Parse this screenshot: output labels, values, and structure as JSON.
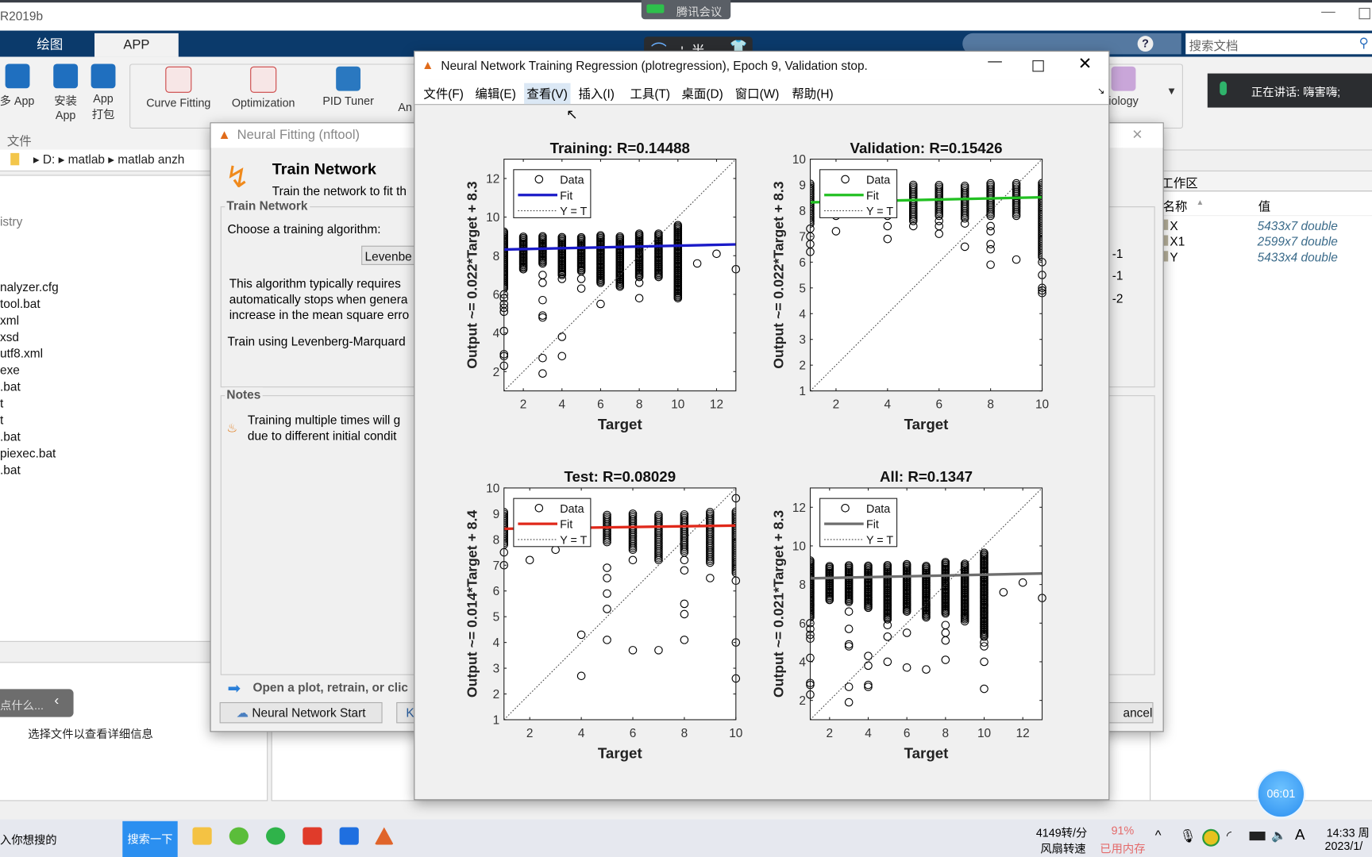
{
  "app": {
    "title": "R2019b"
  },
  "meeting": {
    "badge": "腾讯会议",
    "ime": "', 半",
    "speaking": "正在讲话: 嗨害嗨;"
  },
  "ribbon": {
    "tabs": [
      {
        "label": "绘图"
      },
      {
        "label": "APP",
        "selected": true
      }
    ],
    "file_buttons": [
      {
        "label": "多 App"
      },
      {
        "label": "安装\nApp"
      },
      {
        "label": "App\n打包"
      }
    ],
    "file_section": "文件",
    "apps": [
      {
        "label": "Curve Fitting"
      },
      {
        "label": "Optimization"
      },
      {
        "label": "PID Tuner"
      },
      {
        "label": "An"
      },
      {
        "label": "iology"
      }
    ],
    "search_placeholder": "搜索文档"
  },
  "address": {
    "parts": [
      "D:",
      "matlab",
      "matlab anzh"
    ]
  },
  "files": {
    "items": [
      "istry",
      "nalyzer.cfg",
      "tool.bat",
      "xml",
      "xsd",
      "utf8.xml",
      "exe",
      ".bat",
      "t",
      "t",
      ".bat",
      "piexec.bat",
      ".bat"
    ],
    "details_hint": "选择文件以查看详细信息",
    "search_pill": "点什么..."
  },
  "nftool": {
    "title": "Neural Fitting (nftool)",
    "heading": "Train Network",
    "subheading": "Train the network to fit th",
    "group_train": "Train Network",
    "choose_label": "Choose a training algorithm:",
    "algorithm_value": "Levenbe",
    "desc_lines": [
      "This algorithm typically requires",
      "automatically stops when genera",
      "increase in the mean square erro"
    ],
    "train_using": "Train using Levenberg-Marquard",
    "group_notes": "Notes",
    "notes_lines": [
      "Training multiple times will g",
      "due to different initial condit"
    ],
    "hint": "Open a plot, retrain, or clic",
    "start_button": "Neural Network Start",
    "next_button": "K",
    "cancel_button": "ancel",
    "right_values": [
      "-1",
      "-1",
      "-2"
    ]
  },
  "workspace": {
    "title": "工作区",
    "col_name": "名称",
    "col_value": "值",
    "rows": [
      {
        "name": "X",
        "value": "5433x7 double"
      },
      {
        "name": "X1",
        "value": "2599x7 double"
      },
      {
        "name": "Y",
        "value": "5433x4 double"
      }
    ]
  },
  "plotwin": {
    "title": "Neural Network Training Regression (plotregression), Epoch 9, Validation stop.",
    "menu": [
      "文件(F)",
      "编辑(E)",
      "查看(V)",
      "插入(I)",
      "工具(T)",
      "桌面(D)",
      "窗口(W)",
      "帮助(H)"
    ],
    "active_menu": "查看(V)"
  },
  "chart_data": [
    {
      "type": "scatter",
      "title": "Training: R=0.14488",
      "xlabel": "Target",
      "ylabel": "Output ~= 0.022*Target + 8.3",
      "xlim": [
        1,
        13
      ],
      "ylim": [
        1,
        13
      ],
      "xticks": [
        2,
        4,
        6,
        8,
        10,
        12
      ],
      "yticks": [
        2,
        4,
        6,
        8,
        10,
        12
      ],
      "fit": {
        "slope": 0.022,
        "intercept": 8.3,
        "color": "#1a1ac8"
      },
      "legend": [
        "Data",
        "Fit",
        "Y = T"
      ],
      "legend_position": "top-left",
      "columns": [
        [
          1,
          6.3,
          9.3
        ],
        [
          2,
          7.3,
          9.0
        ],
        [
          3,
          7.6,
          9.0
        ],
        [
          4,
          7.0,
          9.0
        ],
        [
          5,
          7.2,
          9.0
        ],
        [
          6,
          6.6,
          9.1
        ],
        [
          7,
          6.4,
          9.0
        ],
        [
          8,
          6.9,
          9.2
        ],
        [
          9,
          6.9,
          9.2
        ],
        [
          10,
          5.8,
          9.6
        ]
      ],
      "points": [
        [
          1,
          6.0
        ],
        [
          1,
          5.8
        ],
        [
          1,
          5.5
        ],
        [
          1,
          5.3
        ],
        [
          1,
          5.1
        ],
        [
          1,
          4.1
        ],
        [
          1,
          2.9
        ],
        [
          1,
          2.8
        ],
        [
          1,
          2.3
        ],
        [
          3,
          7.0
        ],
        [
          3,
          6.6
        ],
        [
          3,
          5.7
        ],
        [
          3,
          4.9
        ],
        [
          3,
          4.8
        ],
        [
          3,
          2.7
        ],
        [
          3,
          1.9
        ],
        [
          4,
          6.8
        ],
        [
          4,
          3.8
        ],
        [
          4,
          2.8
        ],
        [
          5,
          6.8
        ],
        [
          5,
          6.3
        ],
        [
          6,
          5.5
        ],
        [
          8,
          6.6
        ],
        [
          8,
          5.8
        ],
        [
          11,
          7.6
        ],
        [
          12,
          8.1
        ],
        [
          13,
          7.3
        ]
      ]
    },
    {
      "type": "scatter",
      "title": "Validation: R=0.15426",
      "xlabel": "Target",
      "ylabel": "Output ~= 0.022*Target + 8.3",
      "xlim": [
        1,
        10
      ],
      "ylim": [
        1,
        10
      ],
      "xticks": [
        2,
        4,
        6,
        8,
        10
      ],
      "yticks": [
        1,
        2,
        3,
        4,
        5,
        6,
        7,
        8,
        9,
        10
      ],
      "fit": {
        "slope": 0.022,
        "intercept": 8.3,
        "color": "#22c022"
      },
      "legend": [
        "Data",
        "Fit",
        "Y = T"
      ],
      "legend_position": "top-left",
      "columns": [
        [
          1,
          7.5,
          9.1
        ],
        [
          5,
          7.6,
          9.0
        ],
        [
          6,
          7.8,
          9.0
        ],
        [
          7,
          7.7,
          9.0
        ],
        [
          8,
          7.8,
          9.1
        ],
        [
          9,
          7.8,
          9.1
        ],
        [
          10,
          6.2,
          9.1
        ]
      ],
      "points": [
        [
          1,
          7.3
        ],
        [
          1,
          7.0
        ],
        [
          1,
          6.7
        ],
        [
          1,
          6.4
        ],
        [
          2,
          7.8
        ],
        [
          2,
          7.2
        ],
        [
          4,
          7.8
        ],
        [
          4,
          7.4
        ],
        [
          4,
          6.9
        ],
        [
          5,
          7.4
        ],
        [
          6,
          7.6
        ],
        [
          6,
          7.4
        ],
        [
          6,
          7.1
        ],
        [
          7,
          7.5
        ],
        [
          7,
          6.6
        ],
        [
          8,
          7.4
        ],
        [
          8,
          7.2
        ],
        [
          8,
          6.7
        ],
        [
          8,
          6.5
        ],
        [
          8,
          5.9
        ],
        [
          9,
          6.1
        ],
        [
          10,
          6.0
        ],
        [
          10,
          5.5
        ],
        [
          10,
          5.0
        ],
        [
          10,
          4.9
        ],
        [
          10,
          4.8
        ]
      ]
    },
    {
      "type": "scatter",
      "title": "Test: R=0.08029",
      "xlabel": "Target",
      "ylabel": "Output ~= 0.014*Target + 8.4",
      "xlim": [
        1,
        10
      ],
      "ylim": [
        1,
        10
      ],
      "xticks": [
        2,
        4,
        6,
        8,
        10
      ],
      "yticks": [
        1,
        2,
        3,
        4,
        5,
        6,
        7,
        8,
        9,
        10
      ],
      "fit": {
        "slope": 0.014,
        "intercept": 8.4,
        "color": "#e0281a"
      },
      "legend": [
        "Data",
        "Fit",
        "Y = T"
      ],
      "legend_position": "top-left",
      "columns": [
        [
          1,
          7.8,
          9.1
        ],
        [
          5,
          7.9,
          9.0
        ],
        [
          6,
          7.6,
          9.0
        ],
        [
          7,
          7.2,
          9.0
        ],
        [
          8,
          7.5,
          9.0
        ],
        [
          9,
          7.1,
          9.1
        ],
        [
          10,
          6.7,
          9.1
        ]
      ],
      "points": [
        [
          1,
          7.5
        ],
        [
          1,
          7.0
        ],
        [
          2,
          7.2
        ],
        [
          3,
          7.6
        ],
        [
          4,
          4.3
        ],
        [
          4,
          2.7
        ],
        [
          5,
          6.9
        ],
        [
          5,
          6.5
        ],
        [
          5,
          5.9
        ],
        [
          5,
          5.3
        ],
        [
          5,
          4.1
        ],
        [
          6,
          7.2
        ],
        [
          6,
          3.7
        ],
        [
          7,
          3.7
        ],
        [
          8,
          7.2
        ],
        [
          8,
          6.8
        ],
        [
          8,
          5.5
        ],
        [
          8,
          5.1
        ],
        [
          8,
          4.1
        ],
        [
          9,
          6.5
        ],
        [
          10,
          9.6
        ],
        [
          10,
          6.4
        ],
        [
          10,
          4.0
        ],
        [
          10,
          2.6
        ]
      ]
    },
    {
      "type": "scatter",
      "title": "All: R=0.1347",
      "xlabel": "Target",
      "ylabel": "Output ~= 0.021*Target + 8.3",
      "xlim": [
        1,
        13
      ],
      "ylim": [
        1,
        13
      ],
      "xticks": [
        2,
        4,
        6,
        8,
        10,
        12
      ],
      "yticks": [
        2,
        4,
        6,
        8,
        10,
        12
      ],
      "fit": {
        "slope": 0.021,
        "intercept": 8.3,
        "color": "#6e6e6e"
      },
      "legend": [
        "Data",
        "Fit",
        "Y = T"
      ],
      "legend_position": "top-left",
      "columns": [
        [
          1,
          6.3,
          9.3
        ],
        [
          2,
          7.2,
          9.0
        ],
        [
          3,
          7.1,
          9.0
        ],
        [
          4,
          6.8,
          9.0
        ],
        [
          5,
          6.2,
          9.0
        ],
        [
          6,
          6.6,
          9.1
        ],
        [
          7,
          6.3,
          9.0
        ],
        [
          8,
          6.5,
          9.2
        ],
        [
          9,
          6.2,
          9.1
        ],
        [
          10,
          5.3,
          9.7
        ]
      ],
      "points": [
        [
          1,
          6.0
        ],
        [
          1,
          5.7
        ],
        [
          1,
          5.4
        ],
        [
          1,
          5.2
        ],
        [
          1,
          4.2
        ],
        [
          1,
          2.9
        ],
        [
          1,
          2.8
        ],
        [
          1,
          2.3
        ],
        [
          3,
          6.6
        ],
        [
          3,
          5.7
        ],
        [
          3,
          4.9
        ],
        [
          3,
          4.8
        ],
        [
          3,
          2.7
        ],
        [
          3,
          1.9
        ],
        [
          4,
          4.3
        ],
        [
          4,
          3.8
        ],
        [
          4,
          2.8
        ],
        [
          4,
          2.7
        ],
        [
          5,
          5.9
        ],
        [
          5,
          5.3
        ],
        [
          5,
          4.0
        ],
        [
          6,
          5.5
        ],
        [
          6,
          3.7
        ],
        [
          7,
          3.6
        ],
        [
          8,
          5.9
        ],
        [
          8,
          5.5
        ],
        [
          8,
          5.1
        ],
        [
          8,
          4.1
        ],
        [
          9,
          6.4
        ],
        [
          9,
          6.1
        ],
        [
          10,
          5.0
        ],
        [
          10,
          4.8
        ],
        [
          10,
          4.0
        ],
        [
          10,
          2.6
        ],
        [
          11,
          7.6
        ],
        [
          12,
          8.1
        ],
        [
          13,
          7.3
        ]
      ]
    }
  ],
  "taskbar": {
    "search_text": "入你想搜的",
    "search_button": "搜索一下",
    "fan_speed": "4149转/分",
    "fan_label": "风扇转速",
    "mem_pct": "91%",
    "mem_label": "已用内存",
    "time": "14:33 周",
    "date": "2023/1/",
    "timer": "06:01"
  }
}
